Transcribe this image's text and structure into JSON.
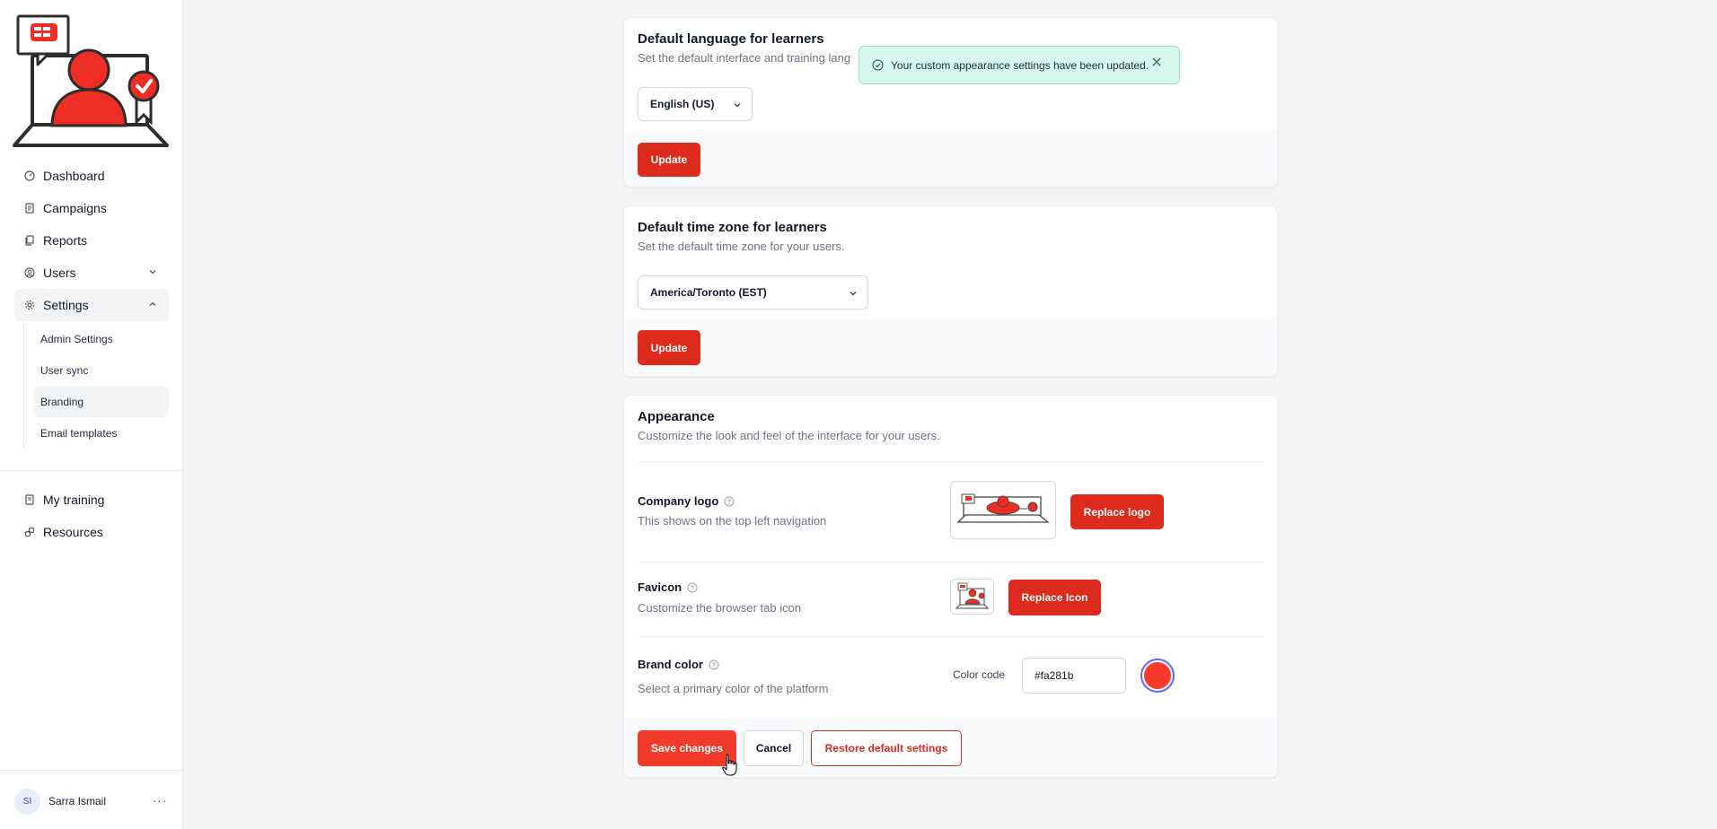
{
  "sidebar": {
    "nav": [
      {
        "label": "Dashboard",
        "icon": "gauge-icon"
      },
      {
        "label": "Campaigns",
        "icon": "document-icon"
      },
      {
        "label": "Reports",
        "icon": "copy-icon"
      },
      {
        "label": "Users",
        "icon": "user-circle-icon"
      },
      {
        "label": "Settings",
        "icon": "gear-icon"
      }
    ],
    "settings_sub": [
      "Admin Settings",
      "User sync",
      "Branding",
      "Email templates"
    ],
    "nav2": [
      {
        "label": "My training",
        "icon": "book-icon"
      },
      {
        "label": "Resources",
        "icon": "link-icon"
      }
    ],
    "user": {
      "initials": "SI",
      "name": "Sarra Ismail",
      "more": "···"
    }
  },
  "toast": {
    "message": "Your custom appearance settings have been updated."
  },
  "language_card": {
    "title": "Default language for learners",
    "description": "Set the default interface and training lang",
    "selected": "English (US)",
    "button": "Update"
  },
  "timezone_card": {
    "title": "Default time zone for learners",
    "description": "Set the default time zone for your users.",
    "selected": "America/Toronto (EST)",
    "button": "Update"
  },
  "appearance_card": {
    "title": "Appearance",
    "description": "Customize the look and feel of the interface for your users.",
    "logo": {
      "label": "Company logo",
      "description": "This shows on the top left navigation",
      "button": "Replace logo"
    },
    "favicon": {
      "label": "Favicon",
      "description": "Customize the browser tab icon",
      "button": "Replace Icon"
    },
    "brand": {
      "label": "Brand color",
      "description": "Select a primary color of the platform",
      "color_label": "Color code",
      "color_value": "#fa281b"
    },
    "save": "Save changes",
    "cancel": "Cancel",
    "restore": "Restore default settings"
  },
  "colors": {
    "accent": "#dc2a1c",
    "brand": "#fa281b",
    "toast_bg": "#d5f7ee"
  }
}
